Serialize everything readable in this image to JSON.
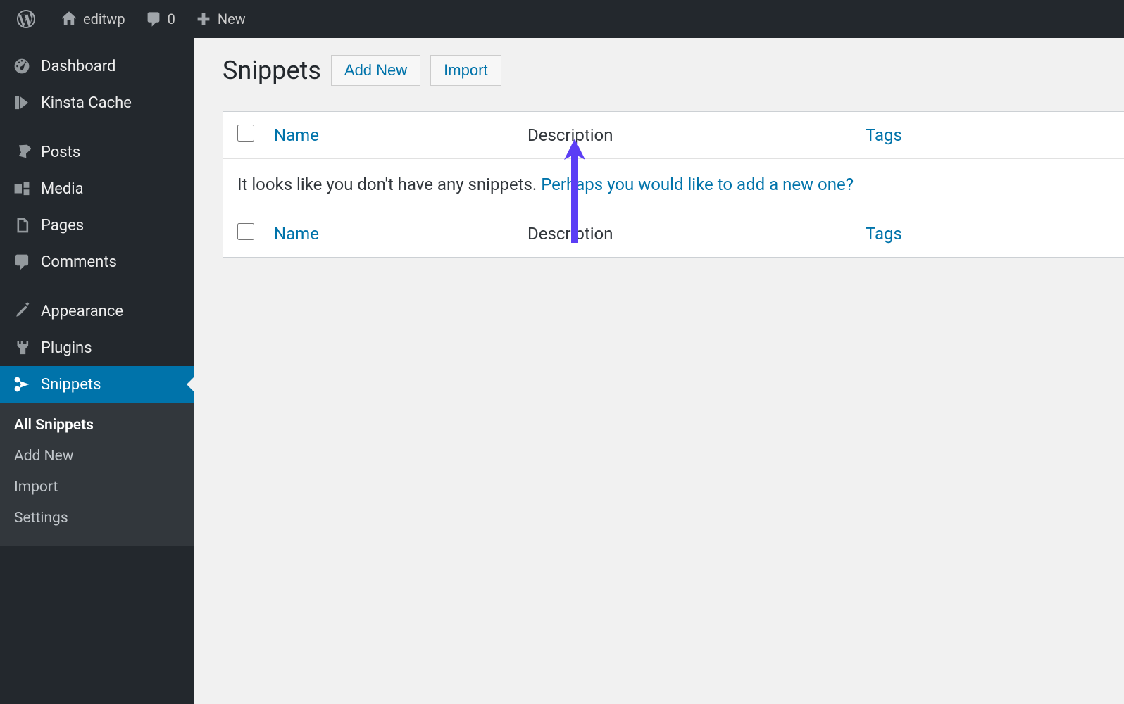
{
  "adminbar": {
    "site_name": "editwp",
    "comments_count": "0",
    "new_label": "New"
  },
  "sidebar": {
    "items": [
      {
        "id": "dashboard",
        "label": "Dashboard"
      },
      {
        "id": "kinsta-cache",
        "label": "Kinsta Cache"
      },
      {
        "id": "posts",
        "label": "Posts"
      },
      {
        "id": "media",
        "label": "Media"
      },
      {
        "id": "pages",
        "label": "Pages"
      },
      {
        "id": "comments",
        "label": "Comments"
      },
      {
        "id": "appearance",
        "label": "Appearance"
      },
      {
        "id": "plugins",
        "label": "Plugins"
      },
      {
        "id": "snippets",
        "label": "Snippets"
      }
    ],
    "submenu": [
      {
        "label": "All Snippets",
        "current": true
      },
      {
        "label": "Add New"
      },
      {
        "label": "Import"
      },
      {
        "label": "Settings"
      }
    ]
  },
  "page": {
    "title": "Snippets",
    "add_new_label": "Add New",
    "import_label": "Import"
  },
  "table": {
    "columns": {
      "name": "Name",
      "description": "Description",
      "tags": "Tags"
    },
    "empty_text": "It looks like you don't have any snippets. ",
    "empty_link": "Perhaps you would like to add a new one?"
  }
}
